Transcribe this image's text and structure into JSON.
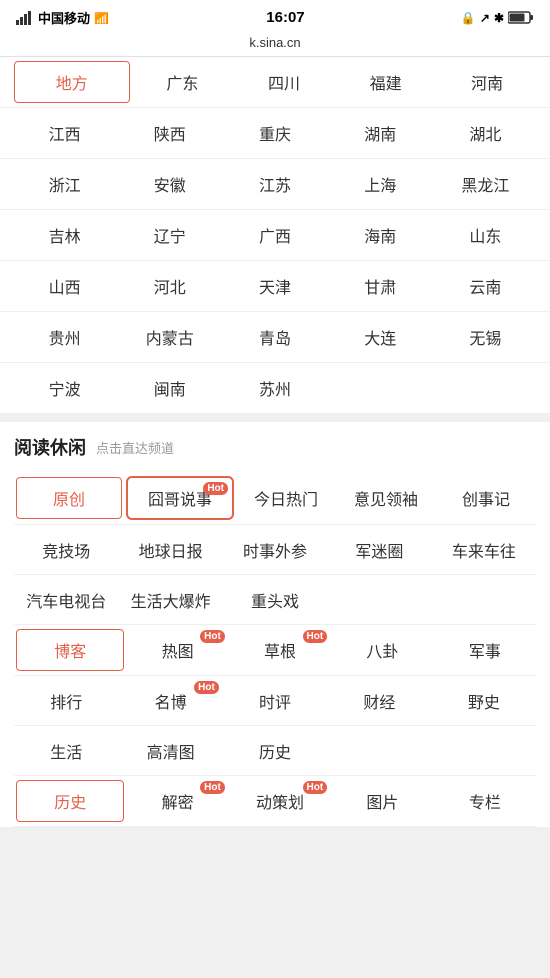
{
  "statusBar": {
    "carrier": "中国移动",
    "time": "16:07",
    "url": "k.sina.cn"
  },
  "regionSection": {
    "rows": [
      [
        "地方",
        "广东",
        "四川",
        "福建",
        "河南"
      ],
      [
        "江西",
        "陕西",
        "重庆",
        "湖南",
        "湖北"
      ],
      [
        "浙江",
        "安徽",
        "江苏",
        "上海",
        "黑龙江"
      ],
      [
        "吉林",
        "辽宁",
        "广西",
        "海南",
        "山东"
      ],
      [
        "山西",
        "河北",
        "天津",
        "甘肃",
        "云南"
      ],
      [
        "贵州",
        "内蒙古",
        "青岛",
        "大连",
        "无锡"
      ],
      [
        "宁波",
        "闽南",
        "苏州",
        "",
        ""
      ]
    ],
    "activeCell": "地方"
  },
  "readingSection": {
    "title": "阅读休闲",
    "subtitle": "点击直达频道",
    "rows": [
      {
        "cells": [
          {
            "label": "原创",
            "active": true,
            "hot": false,
            "highlighted": false
          },
          {
            "label": "囧哥说事",
            "active": false,
            "hot": true,
            "highlighted": true
          },
          {
            "label": "今日热门",
            "active": false,
            "hot": false,
            "highlighted": false
          },
          {
            "label": "意见领袖",
            "active": false,
            "hot": false,
            "highlighted": false
          },
          {
            "label": "创事记",
            "active": false,
            "hot": false,
            "highlighted": false
          }
        ]
      },
      {
        "cells": [
          {
            "label": "竞技场",
            "active": false,
            "hot": false,
            "highlighted": false
          },
          {
            "label": "地球日报",
            "active": false,
            "hot": false,
            "highlighted": false
          },
          {
            "label": "时事外参",
            "active": false,
            "hot": false,
            "highlighted": false
          },
          {
            "label": "军迷圈",
            "active": false,
            "hot": false,
            "highlighted": false
          },
          {
            "label": "车来车往",
            "active": false,
            "hot": false,
            "highlighted": false
          }
        ]
      },
      {
        "cells": [
          {
            "label": "汽车电视台",
            "active": false,
            "hot": false,
            "highlighted": false
          },
          {
            "label": "生活大爆炸",
            "active": false,
            "hot": false,
            "highlighted": false
          },
          {
            "label": "重头戏",
            "active": false,
            "hot": false,
            "highlighted": false
          },
          {
            "label": "",
            "active": false,
            "hot": false,
            "highlighted": false
          },
          {
            "label": "",
            "active": false,
            "hot": false,
            "highlighted": false
          }
        ]
      },
      {
        "cells": [
          {
            "label": "博客",
            "active": true,
            "hot": false,
            "highlighted": false
          },
          {
            "label": "热图",
            "active": false,
            "hot": true,
            "highlighted": false
          },
          {
            "label": "草根",
            "active": false,
            "hot": true,
            "highlighted": false
          },
          {
            "label": "八卦",
            "active": false,
            "hot": false,
            "highlighted": false
          },
          {
            "label": "军事",
            "active": false,
            "hot": false,
            "highlighted": false
          }
        ]
      },
      {
        "cells": [
          {
            "label": "排行",
            "active": false,
            "hot": false,
            "highlighted": false
          },
          {
            "label": "名博",
            "active": false,
            "hot": true,
            "highlighted": false
          },
          {
            "label": "时评",
            "active": false,
            "hot": false,
            "highlighted": false
          },
          {
            "label": "财经",
            "active": false,
            "hot": false,
            "highlighted": false
          },
          {
            "label": "野史",
            "active": false,
            "hot": false,
            "highlighted": false
          }
        ]
      },
      {
        "cells": [
          {
            "label": "生活",
            "active": false,
            "hot": false,
            "highlighted": false
          },
          {
            "label": "高清图",
            "active": false,
            "hot": false,
            "highlighted": false
          },
          {
            "label": "历史",
            "active": false,
            "hot": false,
            "highlighted": false
          },
          {
            "label": "",
            "active": false,
            "hot": false,
            "highlighted": false
          },
          {
            "label": "",
            "active": false,
            "hot": false,
            "highlighted": false
          }
        ]
      },
      {
        "cells": [
          {
            "label": "历史",
            "active": true,
            "hot": false,
            "highlighted": false
          },
          {
            "label": "解密",
            "active": false,
            "hot": true,
            "highlighted": false
          },
          {
            "label": "动策划",
            "active": false,
            "hot": true,
            "highlighted": false
          },
          {
            "label": "图片",
            "active": false,
            "hot": false,
            "highlighted": false
          },
          {
            "label": "专栏",
            "active": false,
            "hot": false,
            "highlighted": false
          }
        ]
      }
    ]
  }
}
